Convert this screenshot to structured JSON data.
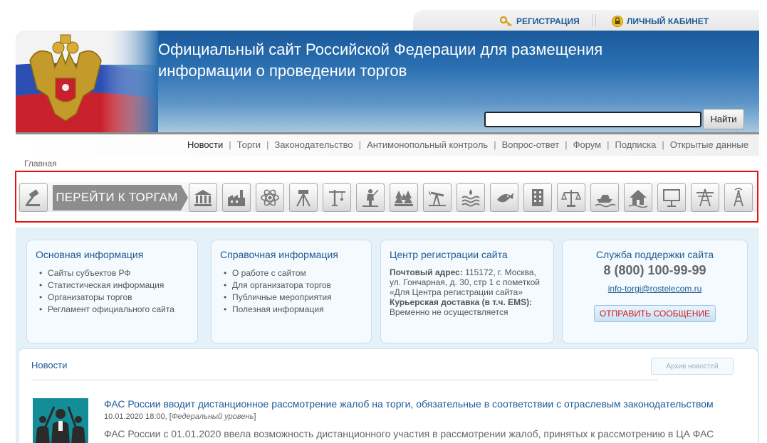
{
  "topbar": {
    "register": "РЕГИСТРАЦИЯ",
    "cabinet": "ЛИЧНЫЙ КАБИНЕТ"
  },
  "header": {
    "title_line1": "Официальный сайт Российской Федерации для размещения",
    "title_line2": "информации о проведении торгов",
    "search_value": "",
    "search_button": "Найти"
  },
  "nav": {
    "items": [
      "Новости",
      "Торги",
      "Законодательство",
      "Антимонопольный контроль",
      "Вопрос-ответ",
      "Форум",
      "Подписка",
      "Открытые данные"
    ],
    "active": "Новости"
  },
  "breadcrumb": "Главная",
  "categories": {
    "goto_label": "ПЕРЕЙТИ К ТОРГАМ",
    "icons": [
      "gavel-icon",
      "government-building-icon",
      "factory-icon",
      "atom-icon",
      "surveyor-tripod-icon",
      "tower-crane-icon",
      "hunter-icon",
      "forest-icon",
      "oil-pump-icon",
      "water-resources-icon",
      "fish-icon",
      "apartment-building-icon",
      "justice-scales-icon",
      "boat-icon",
      "house-icon",
      "billboard-icon",
      "power-line-icon",
      "radio-tower-icon"
    ]
  },
  "info": {
    "main": {
      "title": "Основная информация",
      "items": [
        "Сайты субъектов РФ",
        "Статистическая информация",
        "Организаторы торгов",
        "Регламент официального сайта"
      ]
    },
    "reference": {
      "title": "Справочная информация",
      "items": [
        "О работе с сайтом",
        "Для организатора торгов",
        "Публичные мероприятия",
        "Полезная информация"
      ]
    },
    "registration": {
      "title": "Центр регистрации сайта",
      "postal_label": "Почтовый адрес:",
      "postal_line1": " 115172, г. Москва,",
      "postal_line2": "ул. Гончарная, д. 30, стр 1 с пометкой",
      "postal_line3": "«Для Центра регистрации сайта»",
      "courier_label": "Курьерская доставка (в т.ч. EMS):",
      "courier_value": "Временно не осуществляется"
    },
    "support": {
      "title": "Служба поддержки сайта",
      "phone": "8 (800) 100-99-99",
      "email": "info-torgi@rostelecom.ru",
      "button": "ОТПРАВИТЬ СООБЩЕНИЕ"
    }
  },
  "news": {
    "title": "Новости",
    "archive_button": "Архив новостей",
    "item": {
      "title": "ФАС России вводит дистанционное рассмотрение жалоб на торги, обязательные в соответствии с отраслевым законодательством",
      "date": "10.01.2020 18:00, [",
      "level": "Федеральный уровень",
      "date_end": "]",
      "text": "ФАС России с 01.01.2020 ввела возможность дистанционного участия в рассмотрении жалоб, принятых к рассмотрению в ЦА ФАС"
    }
  },
  "colors": {
    "link": "#1e5a96",
    "highlight_border": "#e21313",
    "header_blue": "#1b5a9c",
    "panel_bg": "#e5f1f8"
  }
}
